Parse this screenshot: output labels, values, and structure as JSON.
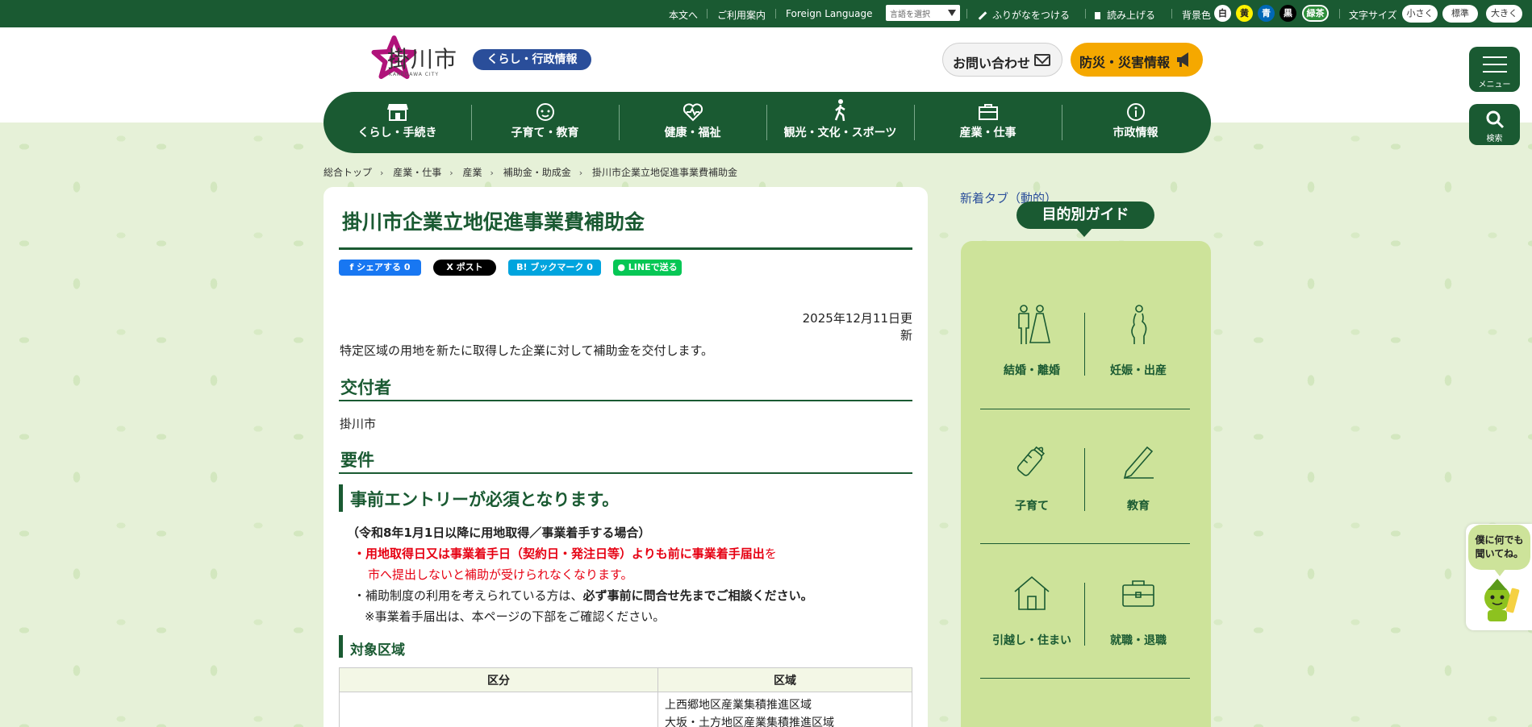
{
  "topbar": {
    "skip": "本文へ",
    "guide": "ご利用案内",
    "foreign": "Foreign Language",
    "lang_placeholder": "言語を選択",
    "furigana": "ふりがなをつける",
    "readaloud": "読み上げる",
    "bg_label": "背景色",
    "bg_colors": [
      {
        "label": "白",
        "color": "#ffffff",
        "text": "#222222"
      },
      {
        "label": "黄",
        "color": "#fff200",
        "text": "#222222"
      },
      {
        "label": "青",
        "color": "#0068b7",
        "text": "#ffffff"
      },
      {
        "label": "黒",
        "color": "#000000",
        "text": "#ffffff"
      },
      {
        "label": "緑茶",
        "color": "#2d8f3a",
        "text": "#ffffff"
      }
    ],
    "fontsize_label": "文字サイズ",
    "sizes": [
      "小さく",
      "標準",
      "大きく"
    ]
  },
  "header": {
    "logo_title": "掛川市",
    "logo_sub": "KAKEGAWA CITY",
    "section_badge": "くらし・行政情報",
    "contact": "お問い合わせ",
    "disaster": "防災・災害情報",
    "menu": "メニュー",
    "search": "検索"
  },
  "nav": [
    {
      "label": "くらし・手続き",
      "icon": "shop-icon"
    },
    {
      "label": "子育て・教育",
      "icon": "baby-icon"
    },
    {
      "label": "健康・福祉",
      "icon": "heart-pulse-icon"
    },
    {
      "label": "観光・文化・スポーツ",
      "icon": "walking-icon"
    },
    {
      "label": "産業・仕事",
      "icon": "briefcase-icon"
    },
    {
      "label": "市政情報",
      "icon": "info-icon"
    }
  ],
  "breadcrumb": [
    "総合トップ",
    "産業・仕事",
    "産業",
    "補助金・助成金",
    "掛川市企業立地促進事業費補助金"
  ],
  "article": {
    "title": "掛川市企業立地促進事業費補助金",
    "share": {
      "facebook": "シェアする 0",
      "x": "ポスト",
      "hatena": "B! ブックマーク 0",
      "line": "LINEで送る"
    },
    "updated": "2025年12月11日更新",
    "intro": "特定区域の用地を新たに取得した企業に対して補助金を交付します。",
    "h_grantor": "交付者",
    "grantor": "掛川市",
    "h_requirements": "要件",
    "h_entry": "事前エントリーが必須となります。",
    "cond": "（令和8年1月1日以降に用地取得／事業着手する場合）",
    "note1_red": "・用地取得日又は事業着手日（契約日・発注日等）よりも前に事業着手届出",
    "note1_tail": "を",
    "note1_line2": "市へ提出しないと補助が受けられなくなります。",
    "note2_pre": "・補助制度の利用を考えられている方は、",
    "note2_bold": "必ず事前に問合せ先までご相談ください。",
    "note3": "※事業着手届出は、本ページの下部をご確認ください。",
    "h_area": "対象区域",
    "table": {
      "headers": [
        "区分",
        "区域"
      ],
      "rows": [
        {
          "category": "",
          "areas": [
            "上西郷地区産業集積推進区域",
            "大坂・土方地区産業集積推進区域"
          ]
        }
      ]
    }
  },
  "sidebar": {
    "new_tab": "新着タブ（動的）",
    "guide_title": "目的別ガイド",
    "guides": [
      {
        "label": "結婚・離婚",
        "icon": "wedding-icon"
      },
      {
        "label": "妊娠・出産",
        "icon": "pregnancy-icon"
      },
      {
        "label": "子育て",
        "icon": "baby-bottle-icon"
      },
      {
        "label": "教育",
        "icon": "pencil-icon"
      },
      {
        "label": "引越し・住まい",
        "icon": "house-icon"
      },
      {
        "label": "就職・退職",
        "icon": "briefcase-icon"
      }
    ]
  },
  "chatbot": {
    "line1": "僕に何でも",
    "line2": "聞いてね。"
  }
}
